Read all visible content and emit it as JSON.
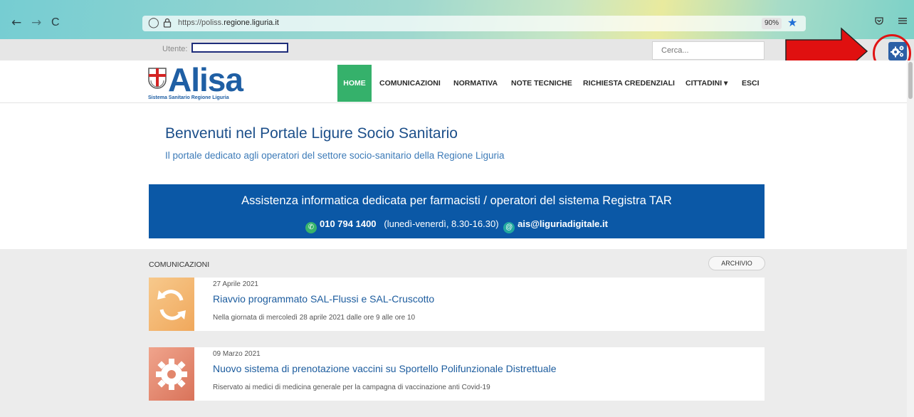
{
  "browser": {
    "back_glyph": "←",
    "forward_glyph": "→",
    "reload_glyph": "C",
    "url_prefix": "https://poliss.",
    "url_domain": "regione.liguria.it",
    "zoom": "90%",
    "accent_color": "#1f6fd6"
  },
  "top_bar": {
    "user_label": "Utente:",
    "search_placeholder": "Cerca..."
  },
  "logo": {
    "name": "Alisa",
    "subtitle": "Sistema Sanitario Regione Liguria",
    "color": "#1f5fa4"
  },
  "nav": {
    "home": "HOME",
    "items": [
      "COMUNICAZIONI",
      "NORMATIVA",
      "NOTE TECNICHE",
      "RICHIESTA CREDENZIALI",
      "CITTADINI ▾",
      "ESCI"
    ],
    "active_color": "#35b16b"
  },
  "welcome": {
    "title": "Benvenuti nel Portale Ligure Socio Sanitario",
    "subtitle": "Il portale dedicato agli operatori del settore socio-sanitario della Regione Liguria"
  },
  "support": {
    "title": "Assistenza informatica dedicata per farmacisti / operatori del sistema Registra TAR",
    "phone": "010 794 1400",
    "hours": "(lunedì-venerdì, 8.30-16.30)",
    "email": "ais@liguriadigitale.it",
    "bg_color": "#0b58a6"
  },
  "comunicazioni": {
    "heading": "COMUNICAZIONI",
    "archive_label": "ARCHIVIO",
    "items": [
      {
        "date": "27 Aprile 2021",
        "title": "Riavvio programmato SAL-Flussi e SAL-Cruscotto",
        "description": "Nella giornata di mercoledì 28 aprile 2021 dalle ore 9 alle ore 10",
        "icon": "refresh-icon"
      },
      {
        "date": "09 Marzo 2021",
        "title": "Nuovo sistema di prenotazione vaccini su Sportello Polifunzionale Distrettuale",
        "description": "Riservato ai medici di medicina generale per la campagna di vaccinazione anti Covid-19",
        "icon": "gear-icon"
      }
    ]
  }
}
